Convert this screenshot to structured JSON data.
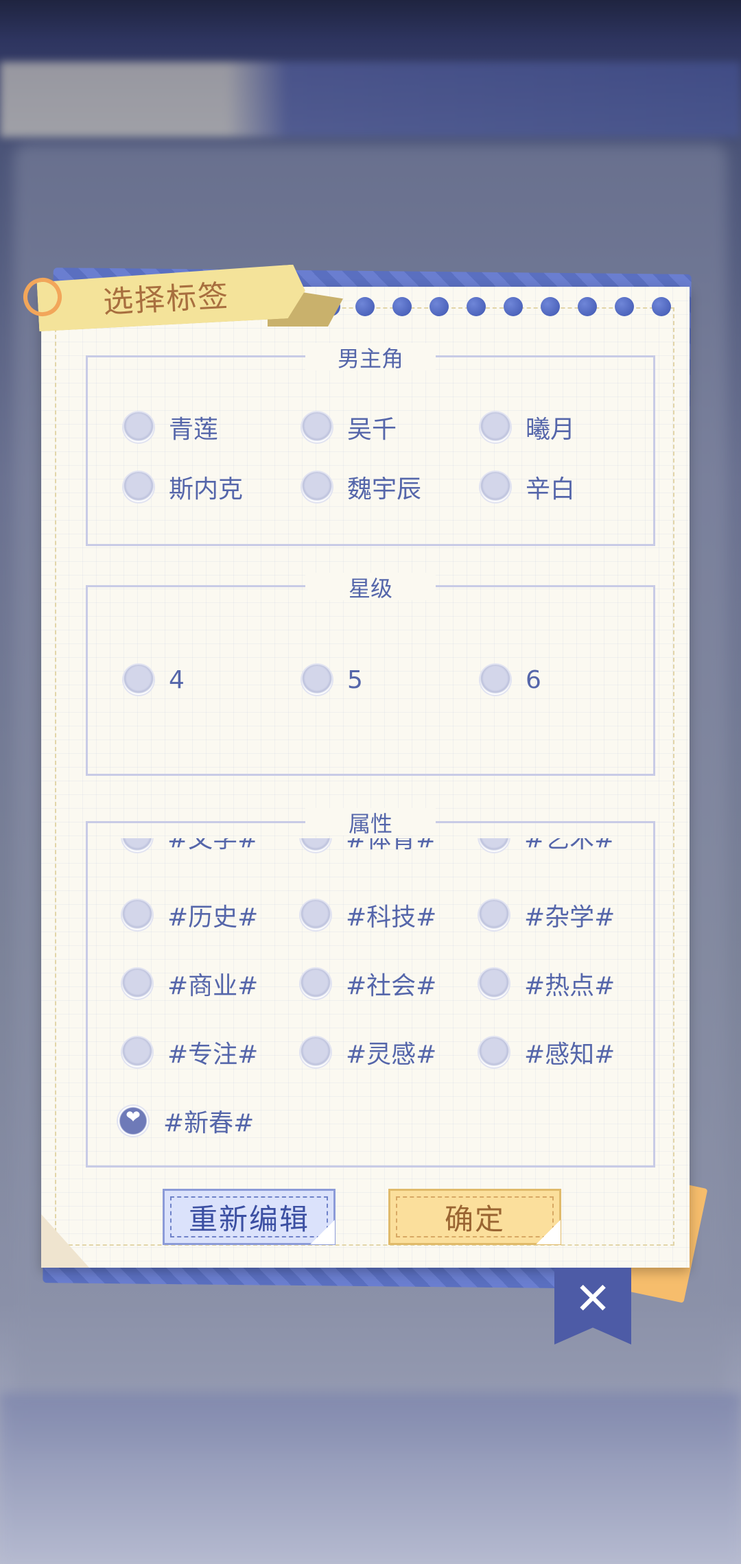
{
  "dialog": {
    "title": "选择标签",
    "sections": {
      "male_lead": {
        "title": "男主角",
        "options": [
          "青莲",
          "吴千",
          "曦月",
          "斯内克",
          "魏宇辰",
          "辛白"
        ]
      },
      "star_level": {
        "title": "星级",
        "options": [
          "4",
          "5",
          "6"
        ]
      },
      "attribute": {
        "title": "属性",
        "options": [
          "#文学#",
          "#体育#",
          "#艺术#",
          "#历史#",
          "#科技#",
          "#杂学#",
          "#商业#",
          "#社会#",
          "#热点#",
          "#专注#",
          "#灵感#",
          "#感知#",
          "#新春#"
        ],
        "selected": "#新春#"
      }
    },
    "buttons": {
      "reset": "重新编辑",
      "confirm": "确定"
    },
    "close_icon": "close-icon"
  },
  "colors": {
    "accent": "#5566aa",
    "paper": "#fbf9f1",
    "confirm": "#fbdf9c",
    "reset": "#dbe2fb"
  }
}
